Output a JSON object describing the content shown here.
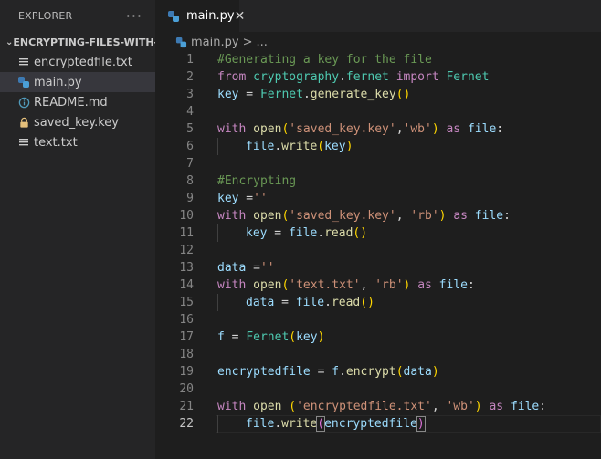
{
  "explorer": {
    "title": "EXPLORER",
    "more": "···",
    "folder": "ENCRYPTING-FILES-WITH-...",
    "files": [
      {
        "name": "encryptedfile.txt",
        "icon": "lines-file-icon"
      },
      {
        "name": "main.py",
        "icon": "python-icon",
        "active": true
      },
      {
        "name": "README.md",
        "icon": "info-icon"
      },
      {
        "name": "saved_key.key",
        "icon": "key-lock-icon"
      },
      {
        "name": "text.txt",
        "icon": "lines-file-icon"
      }
    ]
  },
  "tab": {
    "label": "main.py",
    "close": "✕"
  },
  "breadcrumb": {
    "file": "main.py",
    "sep": ">",
    "more": "..."
  },
  "colors": {
    "keyword": "#c586c0",
    "string": "#ce9178",
    "comment": "#6a9955",
    "function": "#dcdcaa",
    "variable": "#9cdcfe",
    "class": "#4ec9b0",
    "bracket1": "#ffd700",
    "bracket2": "#da70d6"
  },
  "code": [
    {
      "n": "1",
      "t": [
        [
          "c",
          "#Generating a key for the file"
        ]
      ]
    },
    {
      "n": "2",
      "t": [
        [
          "k",
          "from"
        ],
        [
          "p",
          " "
        ],
        [
          "cl",
          "cryptography"
        ],
        [
          "p",
          "."
        ],
        [
          "cl",
          "fernet"
        ],
        [
          "p",
          " "
        ],
        [
          "k",
          "import"
        ],
        [
          "p",
          " "
        ],
        [
          "cl",
          "Fernet"
        ]
      ]
    },
    {
      "n": "3",
      "t": [
        [
          "v",
          "key"
        ],
        [
          "p",
          " = "
        ],
        [
          "cl",
          "Fernet"
        ],
        [
          "p",
          "."
        ],
        [
          "f",
          "generate_key"
        ],
        [
          "b1",
          "()"
        ]
      ]
    },
    {
      "n": "4",
      "t": []
    },
    {
      "n": "5",
      "t": [
        [
          "k",
          "with"
        ],
        [
          "p",
          " "
        ],
        [
          "f",
          "open"
        ],
        [
          "b1",
          "("
        ],
        [
          "s",
          "'saved_key.key'"
        ],
        [
          "p",
          ","
        ],
        [
          "s",
          "'wb'"
        ],
        [
          "b1",
          ")"
        ],
        [
          "p",
          " "
        ],
        [
          "k",
          "as"
        ],
        [
          "p",
          " "
        ],
        [
          "v",
          "file"
        ],
        [
          "p",
          ":"
        ]
      ]
    },
    {
      "n": "6",
      "t": [
        [
          "i",
          ""
        ],
        [
          "v",
          "file"
        ],
        [
          "p",
          "."
        ],
        [
          "f",
          "write"
        ],
        [
          "b1",
          "("
        ],
        [
          "v",
          "key"
        ],
        [
          "b1",
          ")"
        ]
      ]
    },
    {
      "n": "7",
      "t": []
    },
    {
      "n": "8",
      "t": [
        [
          "c",
          "#Encrypting"
        ]
      ]
    },
    {
      "n": "9",
      "t": [
        [
          "v",
          "key"
        ],
        [
          "p",
          " ="
        ],
        [
          "s",
          "''"
        ]
      ]
    },
    {
      "n": "10",
      "t": [
        [
          "k",
          "with"
        ],
        [
          "p",
          " "
        ],
        [
          "f",
          "open"
        ],
        [
          "b1",
          "("
        ],
        [
          "s",
          "'saved_key.key'"
        ],
        [
          "p",
          ", "
        ],
        [
          "s",
          "'rb'"
        ],
        [
          "b1",
          ")"
        ],
        [
          "p",
          " "
        ],
        [
          "k",
          "as"
        ],
        [
          "p",
          " "
        ],
        [
          "v",
          "file"
        ],
        [
          "p",
          ":"
        ]
      ]
    },
    {
      "n": "11",
      "t": [
        [
          "i",
          ""
        ],
        [
          "v",
          "key"
        ],
        [
          "p",
          " = "
        ],
        [
          "v",
          "file"
        ],
        [
          "p",
          "."
        ],
        [
          "f",
          "read"
        ],
        [
          "b1",
          "()"
        ]
      ]
    },
    {
      "n": "12",
      "t": []
    },
    {
      "n": "13",
      "t": [
        [
          "v",
          "data"
        ],
        [
          "p",
          " ="
        ],
        [
          "s",
          "''"
        ]
      ]
    },
    {
      "n": "14",
      "t": [
        [
          "k",
          "with"
        ],
        [
          "p",
          " "
        ],
        [
          "f",
          "open"
        ],
        [
          "b1",
          "("
        ],
        [
          "s",
          "'text.txt'"
        ],
        [
          "p",
          ", "
        ],
        [
          "s",
          "'rb'"
        ],
        [
          "b1",
          ")"
        ],
        [
          "p",
          " "
        ],
        [
          "k",
          "as"
        ],
        [
          "p",
          " "
        ],
        [
          "v",
          "file"
        ],
        [
          "p",
          ":"
        ]
      ]
    },
    {
      "n": "15",
      "t": [
        [
          "i",
          ""
        ],
        [
          "v",
          "data"
        ],
        [
          "p",
          " = "
        ],
        [
          "v",
          "file"
        ],
        [
          "p",
          "."
        ],
        [
          "f",
          "read"
        ],
        [
          "b1",
          "()"
        ]
      ]
    },
    {
      "n": "16",
      "t": []
    },
    {
      "n": "17",
      "t": [
        [
          "v",
          "f"
        ],
        [
          "p",
          " = "
        ],
        [
          "cl",
          "Fernet"
        ],
        [
          "b1",
          "("
        ],
        [
          "v",
          "key"
        ],
        [
          "b1",
          ")"
        ]
      ]
    },
    {
      "n": "18",
      "t": []
    },
    {
      "n": "19",
      "t": [
        [
          "v",
          "encryptedfile"
        ],
        [
          "p",
          " = "
        ],
        [
          "v",
          "f"
        ],
        [
          "p",
          "."
        ],
        [
          "f",
          "encrypt"
        ],
        [
          "b1",
          "("
        ],
        [
          "v",
          "data"
        ],
        [
          "b1",
          ")"
        ]
      ]
    },
    {
      "n": "20",
      "t": []
    },
    {
      "n": "21",
      "t": [
        [
          "k",
          "with"
        ],
        [
          "p",
          " "
        ],
        [
          "f",
          "open"
        ],
        [
          "p",
          " "
        ],
        [
          "b1",
          "("
        ],
        [
          "s",
          "'encryptedfile.txt'"
        ],
        [
          "p",
          ", "
        ],
        [
          "s",
          "'wb'"
        ],
        [
          "b1",
          ")"
        ],
        [
          "p",
          " "
        ],
        [
          "k",
          "as"
        ],
        [
          "p",
          " "
        ],
        [
          "v",
          "file"
        ],
        [
          "p",
          ":"
        ]
      ]
    },
    {
      "n": "22",
      "t": [
        [
          "i",
          ""
        ],
        [
          "v",
          "file"
        ],
        [
          "p",
          "."
        ],
        [
          "f",
          "write"
        ],
        [
          "b2bm",
          "("
        ],
        [
          "v",
          "encryptedfile"
        ],
        [
          "b2bm",
          ")"
        ],
        [
          "cur",
          ""
        ]
      ],
      "active": true
    }
  ]
}
